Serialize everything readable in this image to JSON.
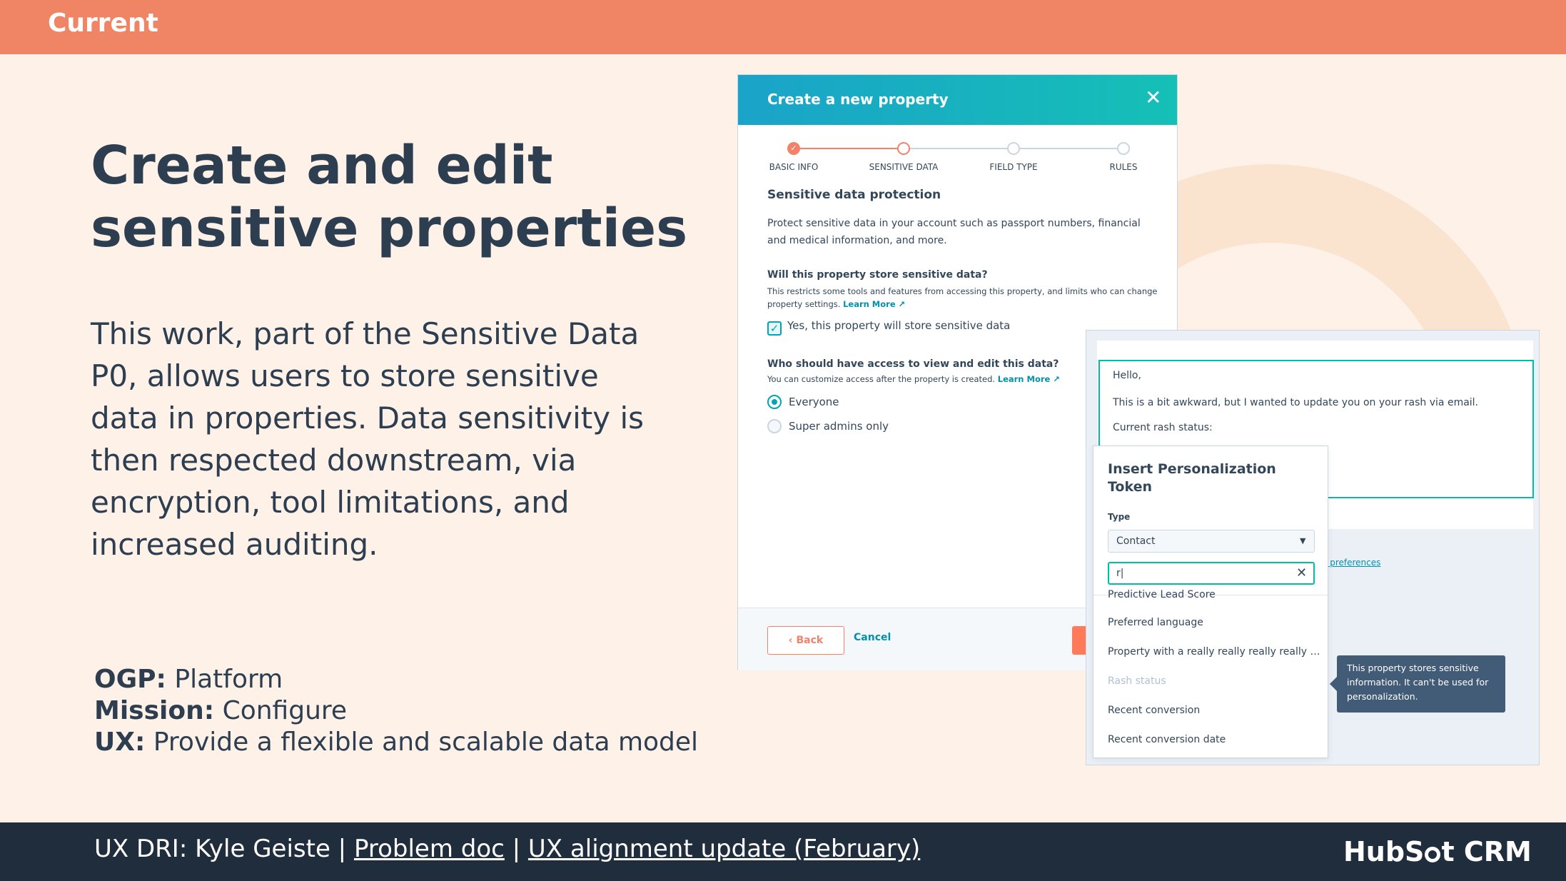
{
  "topbar": {
    "label": "Current"
  },
  "headline": "Create and edit sensitive properties",
  "description": "This work, part of the Sensitive Data P0, allows users to store sensitive data in properties. Data sensitivity is then respected downstream, via encryption, tool limitations, and increased auditing.",
  "meta": {
    "ogp_label": "OGP:",
    "ogp_value": " Platform",
    "mission_label": "Mission:",
    "mission_value": " Configure",
    "ux_label": "UX:",
    "ux_value": " Provide a flexible and scalable data model"
  },
  "footer": {
    "dri_text": "UX DRI: Kyle Geiste | ",
    "problem_doc_link": "Problem doc",
    "separator": " | ",
    "alignment_link": "UX alignment update (February)",
    "brand_part1": "HubS",
    "brand_part2": "t CRM"
  },
  "modal": {
    "title": "Create a new property",
    "close_glyph": "✕",
    "steps": [
      "BASIC INFO",
      "SENSITIVE DATA",
      "FIELD TYPE",
      "RULES"
    ],
    "section_title": "Sensitive data protection",
    "section_text": "Protect sensitive data in your account such as passport numbers, financial and medical information, and more.",
    "q1": "Will this property store sensitive data?",
    "q1_help": "This restricts some tools and features from accessing this property, and limits who can change property settings. ",
    "q1_learn": "Learn More",
    "checkbox_label": "Yes, this property will store sensitive data",
    "checkbox_checked": true,
    "q2": "Who should have access to view and edit this data?",
    "q2_help": "You can customize access after the property is created. ",
    "q2_learn": "Learn More",
    "radio_options": [
      "Everyone",
      "Super admins only"
    ],
    "radio_selected": "Everyone",
    "back_label": "Back",
    "cancel_label": "Cancel"
  },
  "email": {
    "greeting": "Hello,",
    "body": "This is a bit awkward, but I wanted to update you on your rash via email.",
    "status": "Current rash status:",
    "preferences_link": "e preferences"
  },
  "token_popover": {
    "title": "Insert Personalization Token",
    "type_label": "Type",
    "type_value": "Contact",
    "search_value": "r|",
    "items": [
      "Predictive Lead Score",
      "Preferred language",
      "Property with a really really really really re...",
      "Rash status",
      "Recent conversion",
      "Recent conversion date"
    ],
    "disabled_item": "Rash status"
  },
  "tooltip": "This property stores sensitive information. It can't be used for personalization.",
  "colors": {
    "accent_orange": "#f08565",
    "navy": "#1f2d3d",
    "teal": "#00a4bd",
    "background": "#fdf1e8"
  }
}
